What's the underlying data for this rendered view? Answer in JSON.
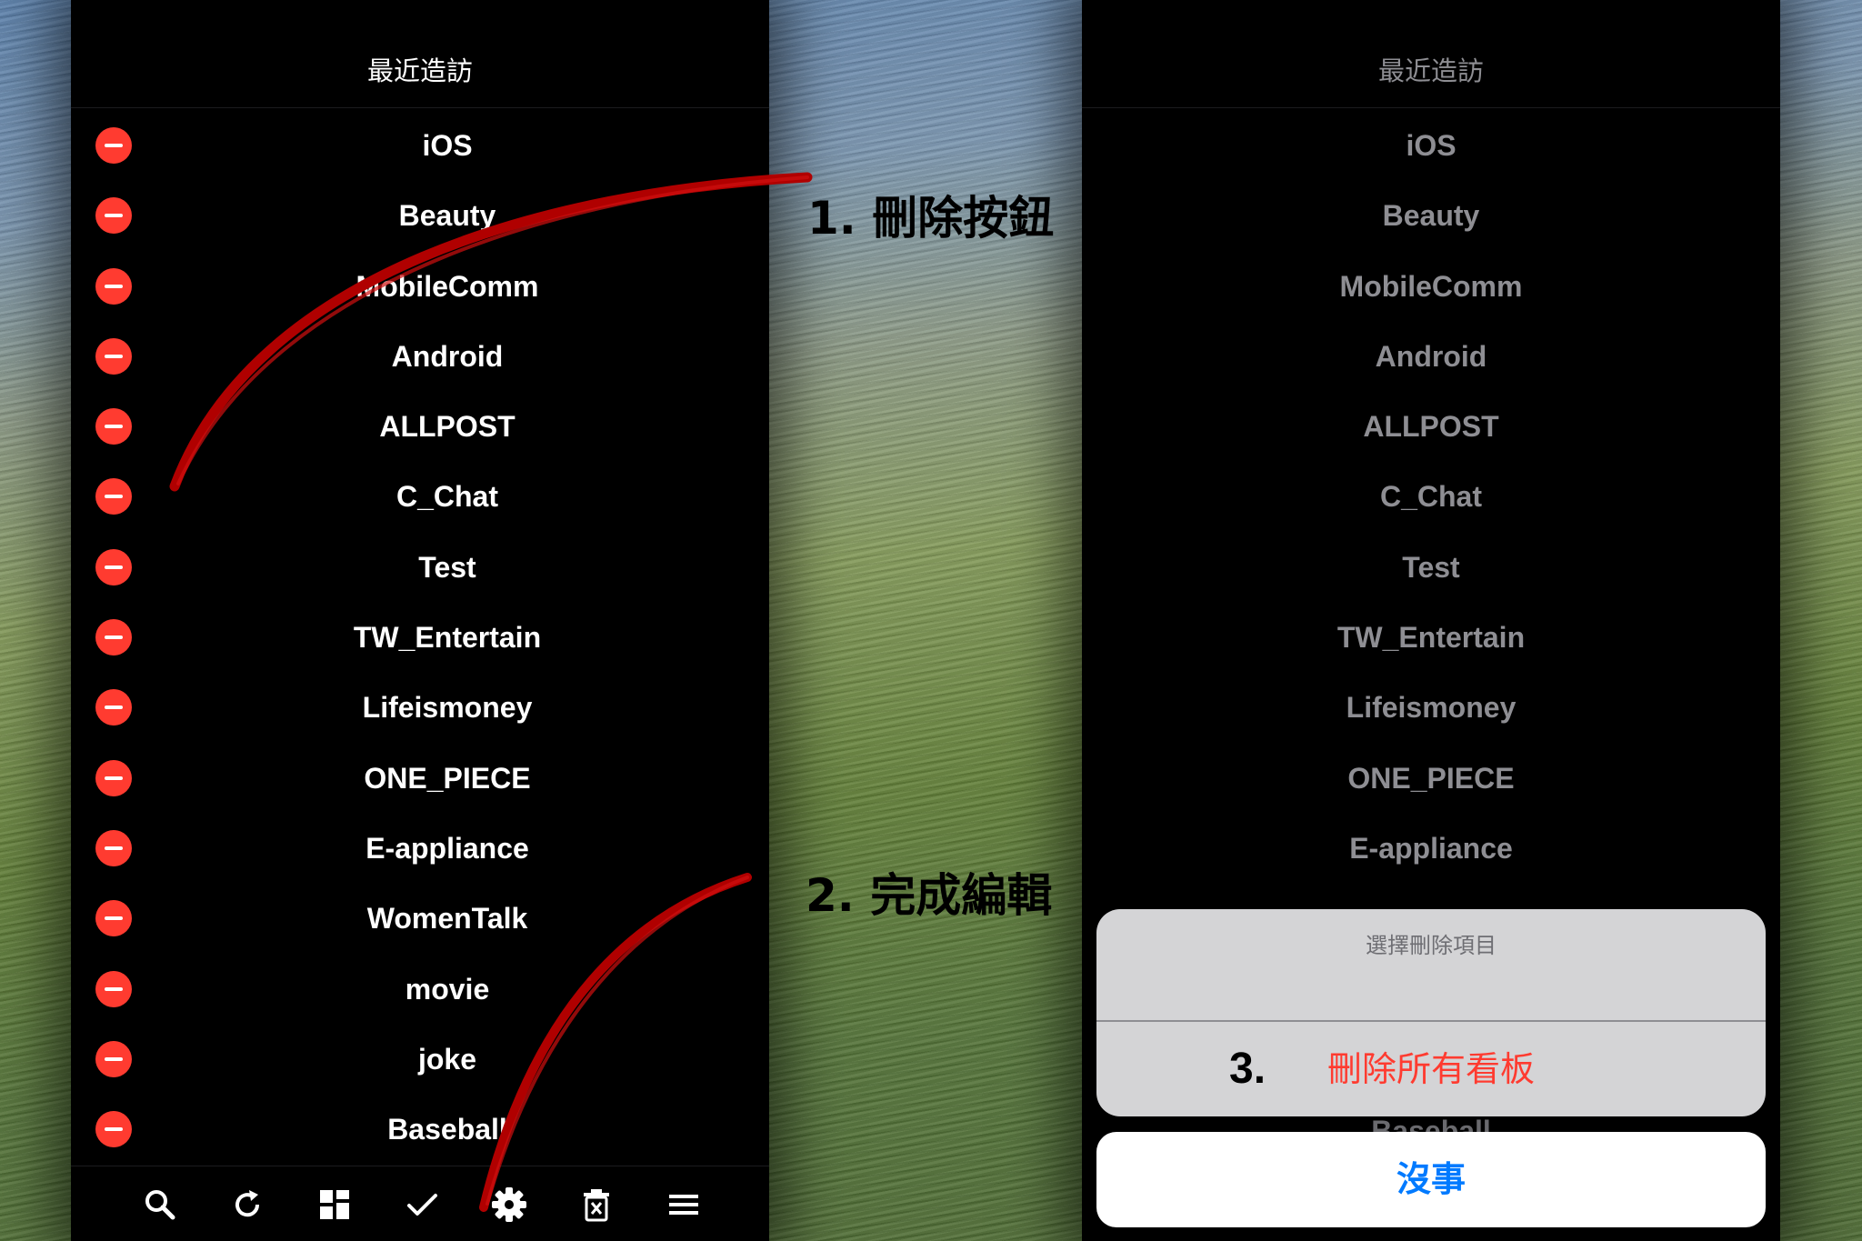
{
  "left_screen": {
    "title": "最近造訪",
    "items": [
      "iOS",
      "Beauty",
      "MobileComm",
      "Android",
      "ALLPOST",
      "C_Chat",
      "Test",
      "TW_Entertain",
      "Lifeismoney",
      "ONE_PIECE",
      "E-appliance",
      "WomenTalk",
      "movie",
      "joke",
      "Baseball"
    ],
    "toolbar_icons": [
      "search-icon",
      "refresh-icon",
      "grid-icon",
      "checkmark-icon",
      "gear-icon",
      "delete-icon",
      "menu-icon"
    ]
  },
  "right_screen": {
    "title": "最近造訪",
    "items": [
      "iOS",
      "Beauty",
      "MobileComm",
      "Android",
      "ALLPOST",
      "C_Chat",
      "Test",
      "TW_Entertain",
      "Lifeismoney",
      "ONE_PIECE",
      "E-appliance"
    ],
    "peek_bottom": "Baseball",
    "action_sheet": {
      "title": "選擇刪除項目",
      "action": "刪除所有看板",
      "cancel": "沒事"
    }
  },
  "annotations": {
    "step1": "1. 刪除按鈕",
    "step2": "2. 完成編輯",
    "step3": "3."
  },
  "colors": {
    "delete_red": "#ff3b30",
    "link_blue": "#007aff",
    "arrow_red": "#b00000"
  }
}
